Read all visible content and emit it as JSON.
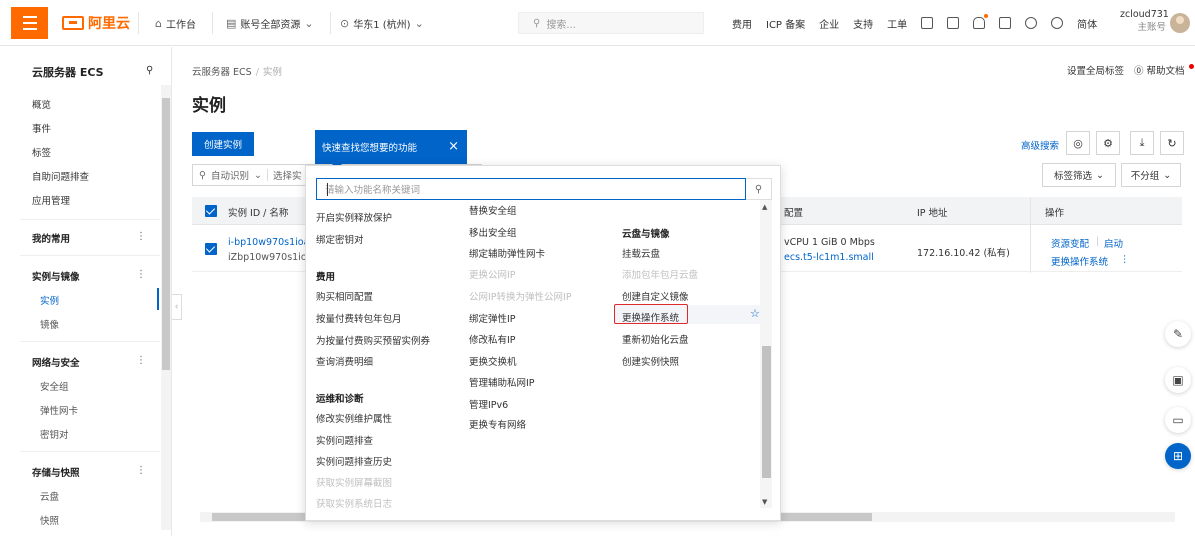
{
  "topbar": {
    "logo": "阿里云",
    "workbench": "工作台",
    "account_scope": "账号全部资源",
    "region": "华东1 (杭州)",
    "search_placeholder": "搜索...",
    "links": [
      "费用",
      "ICP 备案",
      "企业",
      "支持",
      "工单"
    ],
    "lang": "简体",
    "username": "zcloud731",
    "account_type": "主账号"
  },
  "sidebar": {
    "title": "云服务器 ECS",
    "top_items": [
      "概览",
      "事件",
      "标签",
      "自助问题排查",
      "应用管理"
    ],
    "groups": [
      {
        "label": "我的常用",
        "items": []
      },
      {
        "label": "实例与镜像",
        "items": [
          "实例",
          "镜像"
        ]
      },
      {
        "label": "网络与安全",
        "items": [
          "安全组",
          "弹性网卡",
          "密钥对"
        ]
      },
      {
        "label": "存储与快照",
        "items": [
          "云盘",
          "快照"
        ]
      }
    ]
  },
  "main": {
    "breadcrumb_root": "云服务器 ECS",
    "breadcrumb_current": "实例",
    "title": "实例",
    "global_tags": "设置全局标签",
    "help_docs": "帮助文档",
    "create_button": "创建实例",
    "advanced_search": "高级搜索",
    "filter_auto": "自动识别",
    "filter_select": "选择实",
    "tag_filter": "标签筛选",
    "no_group": "不分组",
    "table": {
      "columns": [
        "实例 ID / 名称",
        "配置",
        "IP 地址",
        "操作"
      ],
      "rows": [
        {
          "id": "i-bp10w970s1ioa6",
          "name": "iZbp10w970s1ioa6",
          "config_spec": "vCPU  1 GiB  0 Mbps",
          "config_type": "ecs.t5-lc1m1.small",
          "ip": "172.16.10.42 (私有)",
          "actions": [
            "资源变配",
            "启动",
            "更换操作系统"
          ]
        }
      ]
    }
  },
  "tooltip": {
    "text": "快速查找您想要的功能",
    "close": "×"
  },
  "quick_panel": {
    "input_placeholder": "请输入功能名称关键词",
    "col1": {
      "items_top": [
        "开启实例释放保护",
        "绑定密钥对"
      ],
      "group_fee": "费用",
      "fee_items": [
        "购买相同配置",
        "按量付费转包年包月",
        "为按量付费购买预留实例券",
        "查询消费明细"
      ],
      "group_ops": "运维和诊断",
      "ops_items": [
        "修改实例维护属性",
        "实例问题排查",
        "实例问题排查历史"
      ],
      "ops_disabled": [
        "获取实例屏幕截图",
        "获取实例系统日志"
      ]
    },
    "col2": {
      "items": [
        "替换安全组",
        "移出安全组",
        "绑定辅助弹性网卡"
      ],
      "disabled": [
        "更换公网IP",
        "公网IP转换为弹性公网IP"
      ],
      "items2": [
        "绑定弹性IP",
        "修改私有IP",
        "更换交换机",
        "管理辅助私网IP",
        "管理IPv6",
        "更换专有网络"
      ]
    },
    "col3": {
      "group": "云盘与镜像",
      "items": [
        "挂载云盘"
      ],
      "disabled": [
        "添加包年包月云盘"
      ],
      "items2": [
        "创建自定义镜像",
        "更换操作系统",
        "重新初始化云盘",
        "创建实例快照"
      ]
    }
  }
}
